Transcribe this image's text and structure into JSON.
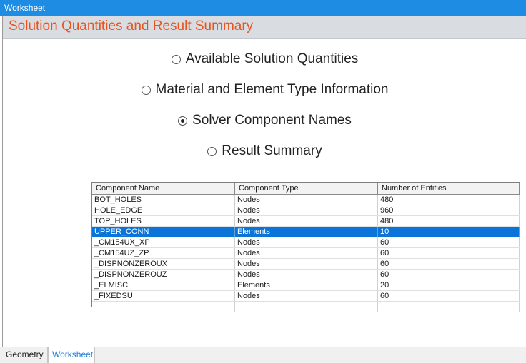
{
  "window": {
    "title": "Worksheet"
  },
  "header": {
    "title": "Solution Quantities and Result Summary"
  },
  "options": [
    {
      "label": "Available Solution Quantities",
      "checked": false
    },
    {
      "label": "Material and Element Type Information",
      "checked": false
    },
    {
      "label": "Solver Component Names",
      "checked": true
    },
    {
      "label": "Result Summary",
      "checked": false
    }
  ],
  "table": {
    "columns": [
      "Component Name",
      "Component Type",
      "Number of Entities"
    ],
    "rows": [
      [
        "BOT_HOLES",
        "Nodes",
        "480"
      ],
      [
        "HOLE_EDGE",
        "Nodes",
        "960"
      ],
      [
        "TOP_HOLES",
        "Nodes",
        "480"
      ],
      [
        "UPPER_CONN",
        "Elements",
        "10"
      ],
      [
        "_CM154UX_XP",
        "Nodes",
        "60"
      ],
      [
        "_CM154UZ_ZP",
        "Nodes",
        "60"
      ],
      [
        "_DISPNONZEROUX",
        "Nodes",
        "60"
      ],
      [
        "_DISPNONZEROUZ",
        "Nodes",
        "60"
      ],
      [
        "_ELMISC",
        "Elements",
        "20"
      ],
      [
        "_FIXEDSU",
        "Nodes",
        "60"
      ]
    ],
    "selected_row": 3
  },
  "tabs": [
    {
      "label": "Geometry",
      "active": false
    },
    {
      "label": "Worksheet",
      "active": true
    }
  ]
}
